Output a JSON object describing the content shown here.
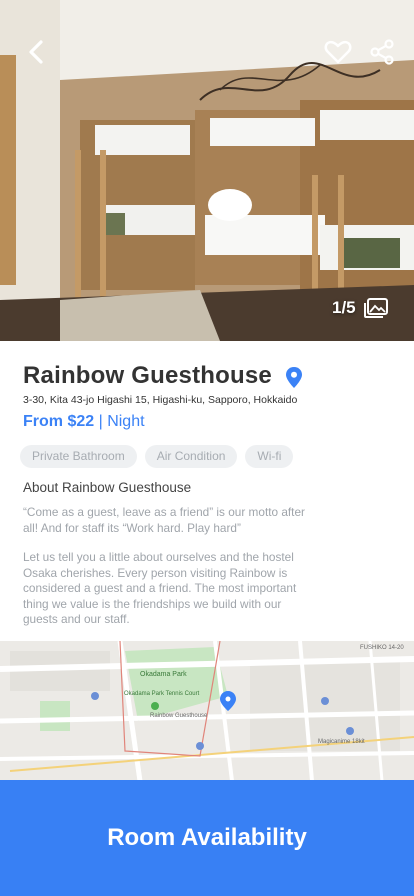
{
  "header": {
    "back_icon": "chevron-left-icon",
    "favorite_icon": "heart-outline-icon",
    "share_icon": "share-icon",
    "photo_counter": "1/5",
    "gallery_icon": "images-icon"
  },
  "hotel": {
    "name": "Rainbow Guesthouse",
    "location_icon": "map-pin-icon",
    "address": "3-30,  Kita 43-jo Higashi 15, Higashi-ku, Sapporo, Hokkaido",
    "price_prefix": "From $22",
    "price_suffix": " | Night",
    "amenities": [
      "Private Bathroom",
      "Air Condition",
      "Wi-fi"
    ],
    "about_heading": "About Rainbow Guesthouse",
    "about_paragraph_1": "“Come as a guest, leave as a friend” is our motto after all! And for staff its “Work hard. Play hard”",
    "about_paragraph_2": "Let us tell you a little about ourselves and the hostel Osaka cherishes. Every person visiting Rainbow is considered a guest and a friend. The most important thing we value is the friendships we build with our guests and our staff."
  },
  "map": {
    "labels": [
      "Okadama Park",
      "Okadama Park Tennis Court",
      "Rainbow Guesthouse",
      "Magicanime 18kit",
      "FUSHIKO 14-20"
    ]
  },
  "cta": {
    "label": "Room Availability"
  },
  "colors": {
    "accent": "#3880f4",
    "price": "#3b82f6",
    "tag_bg": "#eef0f2"
  }
}
